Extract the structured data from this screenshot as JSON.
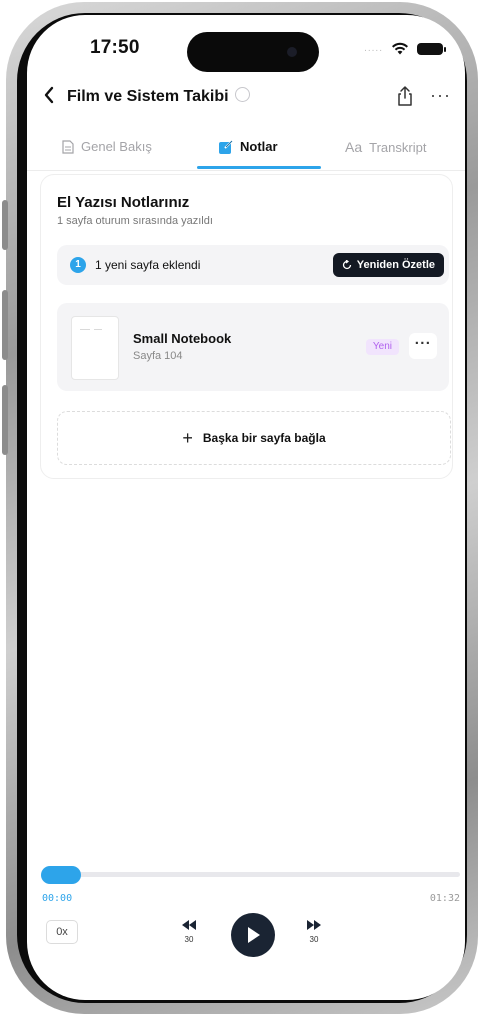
{
  "status_bar": {
    "time": "17:50",
    "signal": "....."
  },
  "nav": {
    "title": "Film ve Sistem Takibi",
    "more": "···"
  },
  "tabs": [
    {
      "label": "Genel Bakış",
      "active": false
    },
    {
      "label": "Notlar",
      "active": true
    },
    {
      "label": "Transkript",
      "active": false,
      "icon_text": "Aa"
    }
  ],
  "card": {
    "title": "El Yazısı Notlarınız",
    "subtitle": "1 sayfa oturum sırasında yazıldı",
    "notice": {
      "count": "1",
      "text": "1 yeni sayfa eklendi",
      "button_label": "Yeniden Özetle"
    },
    "pages": [
      {
        "name": "Small Notebook",
        "page_label": "Sayfa 104",
        "badge": "Yeni",
        "more": "···"
      }
    ],
    "link_page_label": "Başka bir sayfa bağla",
    "plus": "+"
  },
  "player": {
    "current_time": "00:00",
    "total_time": "01:32",
    "speed": "0x",
    "skip_back": "30",
    "skip_forward": "30",
    "progress": 0.0
  },
  "colors": {
    "accent": "#2da4ea",
    "dark_button": "#141923",
    "badge_text": "#b061ee",
    "badge_bg": "#f1e4fd"
  }
}
